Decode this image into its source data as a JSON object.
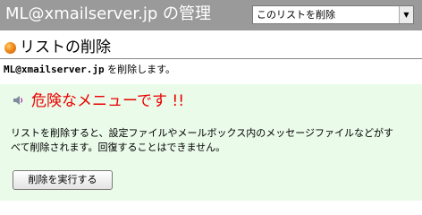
{
  "header": {
    "title": "ML@xmailserver.jp の管理",
    "list_action_select": {
      "selected": "このリストを削除"
    }
  },
  "section": {
    "title": "リストの削除"
  },
  "message": {
    "list_address": "ML@xmailserver.jp",
    "text": " を削除します。"
  },
  "warning": {
    "title": "危険なメニューです !!",
    "lines": [
      "リストを削除すると、設定ファイルやメールボックス内のメッセージファイルなどがす",
      "べて削除されます。回復することはできません。"
    ]
  },
  "actions": {
    "execute_label": "削除を実行する"
  },
  "colors": {
    "header_bg": "#9a9a9a",
    "panel_bg": "#eafbe9",
    "warning_title": "#ea0000",
    "bullet": "#f08a20"
  },
  "icons": {
    "section_bullet": "orange-ball-icon",
    "warning_icon": "speaker-icon",
    "select_arrow": "chevron-down-icon"
  }
}
